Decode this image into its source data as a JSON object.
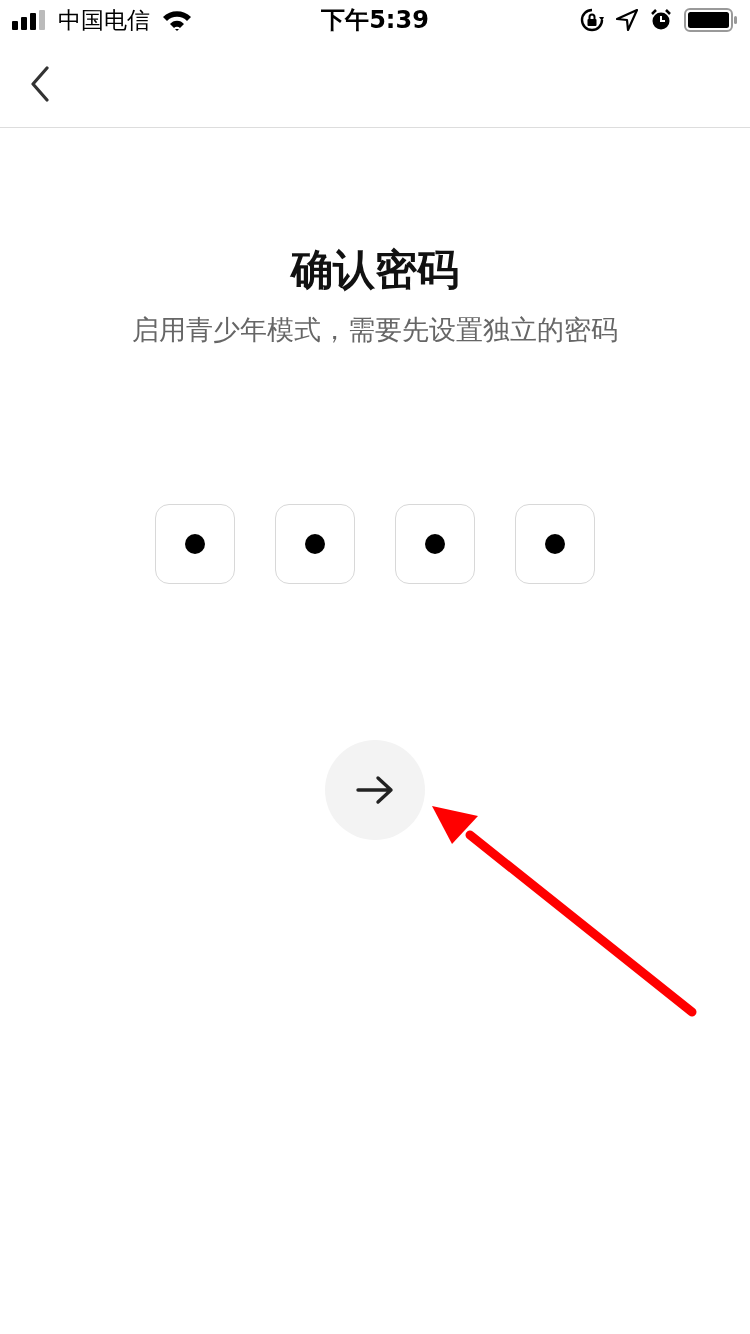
{
  "status_bar": {
    "carrier": "中国电信",
    "time": "下午5:39"
  },
  "title": "确认密码",
  "subtitle": "启用青少年模式，需要先设置独立的密码",
  "pin_boxes": [
    {
      "filled": true
    },
    {
      "filled": true
    },
    {
      "filled": true
    },
    {
      "filled": true
    }
  ],
  "annotation": {
    "kind": "arrow"
  }
}
